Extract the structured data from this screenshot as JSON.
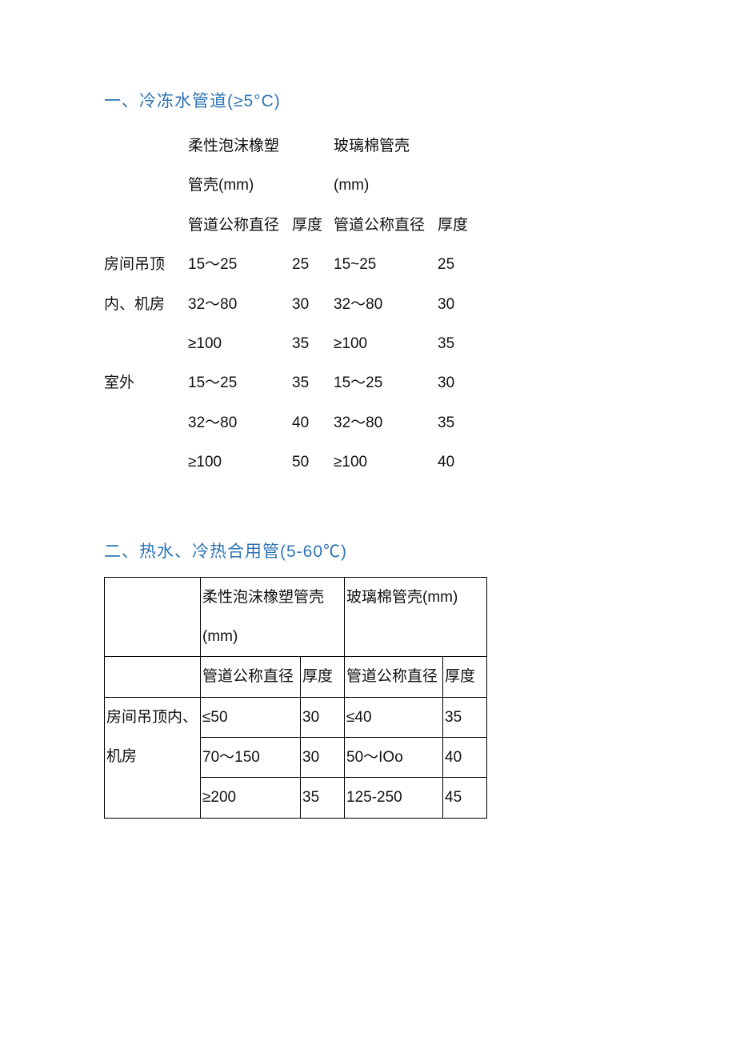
{
  "section1": {
    "title": "一、冷冻水管道(≥5°C)",
    "col_group_a": "柔性泡沫橡塑管壳(mm)",
    "col_group_b": "玻璃棉管壳(mm)",
    "sub_a1": "管道公称直径",
    "sub_a2": "厚度",
    "sub_b1": "管道公称直径",
    "sub_b2": "厚度",
    "loc1": "房间吊顶内、机房",
    "loc2": "室外",
    "rows": [
      {
        "a1": "15～25",
        "a2": "25",
        "b1": "15~25",
        "b2": "25"
      },
      {
        "a1": "32～80",
        "a2": "30",
        "b1": "32～80",
        "b2": "30"
      },
      {
        "a1": "≥100",
        "a2": "35",
        "b1": "≥100",
        "b2": "35"
      },
      {
        "a1": "15～25",
        "a2": "35",
        "b1": "15～25",
        "b2": "30"
      },
      {
        "a1": "32～80",
        "a2": "40",
        "b1": "32～80",
        "b2": "35"
      },
      {
        "a1": "≥100",
        "a2": "50",
        "b1": "≥100",
        "b2": "40"
      }
    ]
  },
  "section2": {
    "title": "二、热水、冷热合用管(5-60℃)",
    "col_group_a": "柔性泡沫橡塑管壳(mm)",
    "col_group_b": "玻璃棉管壳(mm)",
    "sub_a1": "管道公称直径",
    "sub_a2": "厚度",
    "sub_b1": "管道公称直径",
    "sub_b2": "厚度",
    "loc1": "房间吊顶内、机房",
    "rows": [
      {
        "a1": "≤50",
        "a2": "30",
        "b1": "≤40",
        "b2": "35"
      },
      {
        "a1": "70～150",
        "a2": "30",
        "b1": "50～IOo",
        "b2": "40"
      },
      {
        "a1": "≥200",
        "a2": "35",
        "b1": "125-250",
        "b2": "45"
      }
    ]
  }
}
